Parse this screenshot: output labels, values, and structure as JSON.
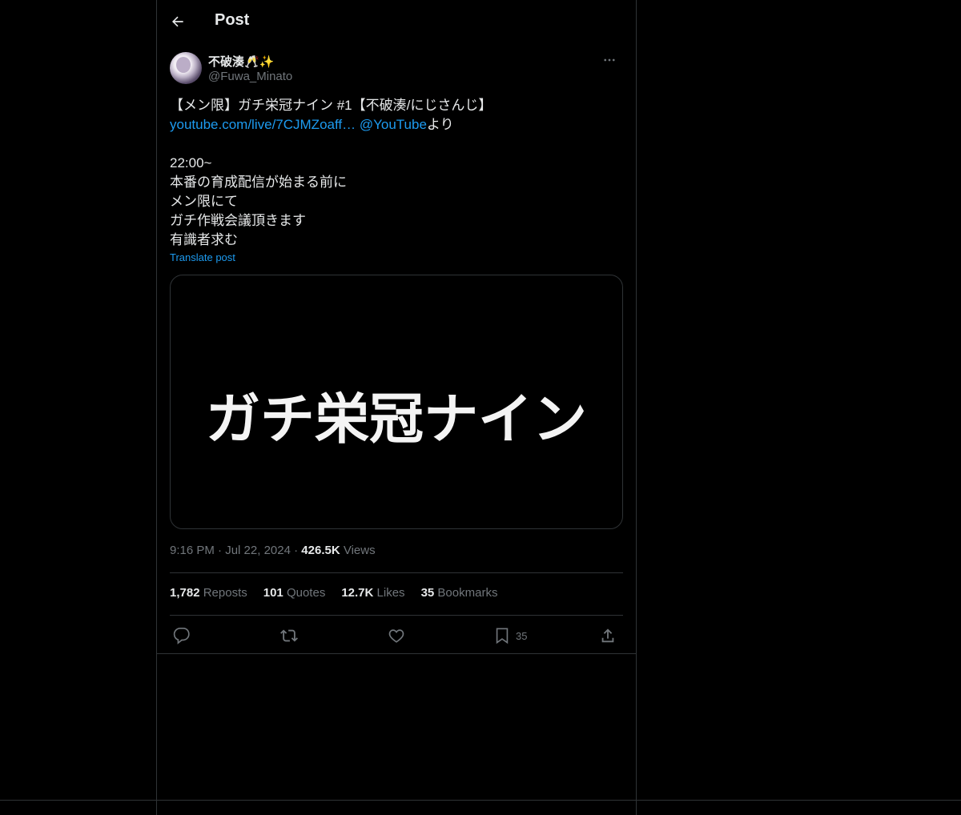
{
  "header": {
    "title": "Post"
  },
  "author": {
    "display_name": "不破湊🥂✨",
    "handle": "@Fuwa_Minato"
  },
  "tweet": {
    "line1": "【メン限】ガチ栄冠ナイン #1【不破湊/にじさんじ】",
    "link_url": "youtube.com/live/7CJMZoaff…",
    "mention": "@YouTube",
    "suffix": "より",
    "line_time": "22:00~",
    "line3": "本番の育成配信が始まる前に",
    "line4": "メン限にて",
    "line5": "ガチ作戦会議頂きます",
    "line6": "有識者求む",
    "translate_label": "Translate post"
  },
  "media": {
    "text": "ガチ栄冠ナイン"
  },
  "meta": {
    "time": "9:16 PM",
    "date": "Jul 22, 2024",
    "views_count": "426.5K",
    "views_label": "Views"
  },
  "stats": {
    "reposts_count": "1,782",
    "reposts_label": "Reposts",
    "quotes_count": "101",
    "quotes_label": "Quotes",
    "likes_count": "12.7K",
    "likes_label": "Likes",
    "bookmarks_count": "35",
    "bookmarks_label": "Bookmarks"
  },
  "actions": {
    "bookmark_count": "35",
    "icons": [
      "reply-icon",
      "repost-icon",
      "like-icon",
      "bookmark-icon",
      "share-icon"
    ]
  },
  "colors": {
    "background": "#000000",
    "text": "#e7e9ea",
    "secondary": "#71767b",
    "accent": "#1d9bf0",
    "border": "#2f3336"
  }
}
